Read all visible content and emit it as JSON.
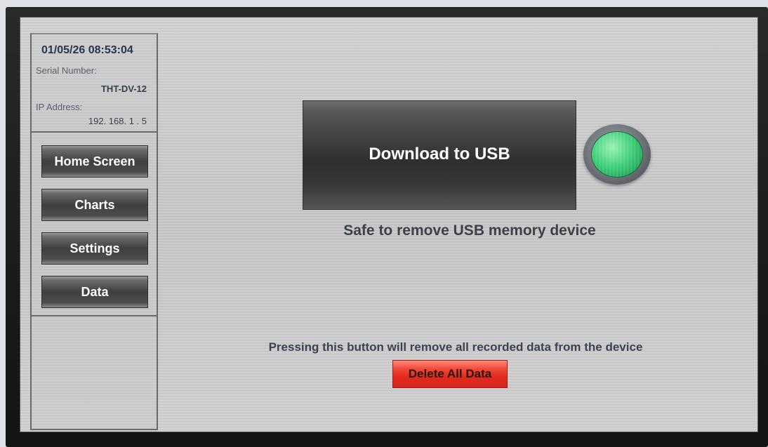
{
  "sidebar": {
    "datetime": "01/05/26   08:53:04",
    "serial_label": "Serial Number:",
    "serial_value": "THT-DV-12",
    "ip_label": "IP Address:",
    "ip_value": "192. 168.  1  .  5",
    "nav": [
      {
        "label": "Home Screen"
      },
      {
        "label": "Charts"
      },
      {
        "label": "Settings"
      },
      {
        "label": "Data"
      }
    ]
  },
  "main": {
    "download_label": "Download to USB",
    "indicator_state": "ready",
    "indicator_color": "#3fd07a",
    "status_text": "Safe to remove USB memory device",
    "warning_text": "Pressing this button will remove all recorded data from the device",
    "delete_label": "Delete All Data"
  }
}
